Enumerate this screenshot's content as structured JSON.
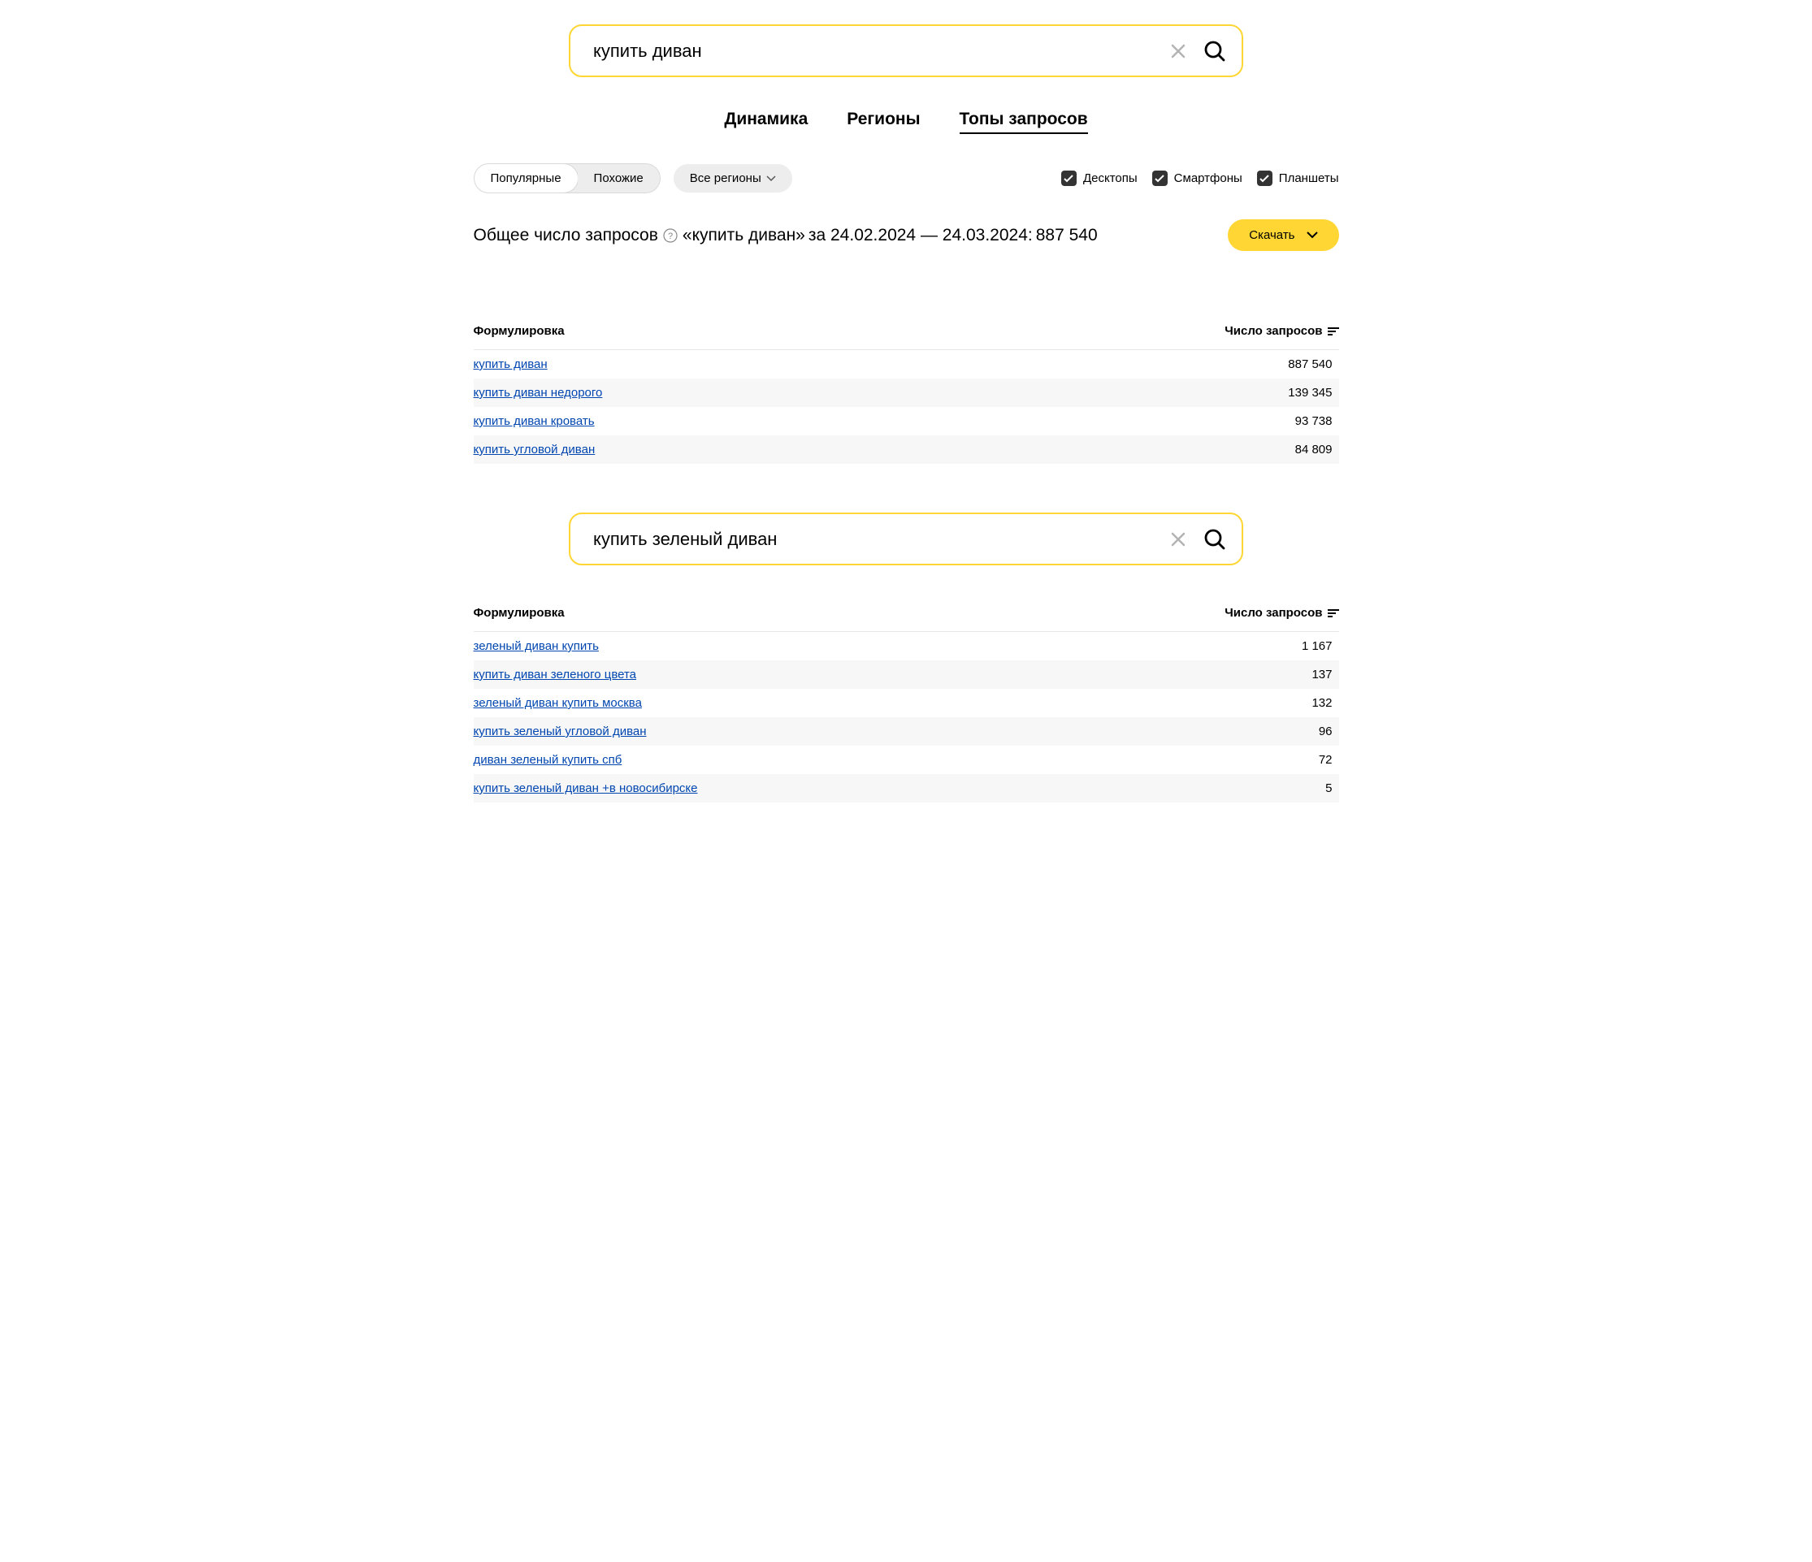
{
  "search1": {
    "value": "купить диван"
  },
  "search2": {
    "value": "купить зеленый диван"
  },
  "tabs": {
    "dynamics": "Динамика",
    "regions": "Регионы",
    "tops": "Топы запросов"
  },
  "filters": {
    "popular": "Популярные",
    "similar": "Похожие",
    "region": "Все регионы",
    "desktop": "Десктопы",
    "smartphone": "Смартфоны",
    "tablet": "Планшеты"
  },
  "summary": {
    "prefix": "Общее число запросов",
    "quote": "«купить диван»",
    "period": "за 24.02.2024 — 24.03.2024:",
    "total": "887 540"
  },
  "download": "Скачать",
  "table_headers": {
    "phrase": "Формулировка",
    "count": "Число запросов"
  },
  "table1": [
    {
      "phrase": "купить диван",
      "count": "887 540"
    },
    {
      "phrase": "купить диван недорого",
      "count": "139 345"
    },
    {
      "phrase": "купить диван кровать",
      "count": "93 738"
    },
    {
      "phrase": "купить угловой диван",
      "count": "84 809"
    }
  ],
  "table2": [
    {
      "phrase": "зеленый диван купить",
      "count": "1 167"
    },
    {
      "phrase": "купить диван зеленого цвета",
      "count": "137"
    },
    {
      "phrase": "зеленый диван купить москва",
      "count": "132"
    },
    {
      "phrase": "купить зеленый угловой диван",
      "count": "96"
    },
    {
      "phrase": "диван зеленый купить спб",
      "count": "72"
    },
    {
      "phrase": "купить зеленый диван +в новосибирске",
      "count": "5"
    }
  ]
}
